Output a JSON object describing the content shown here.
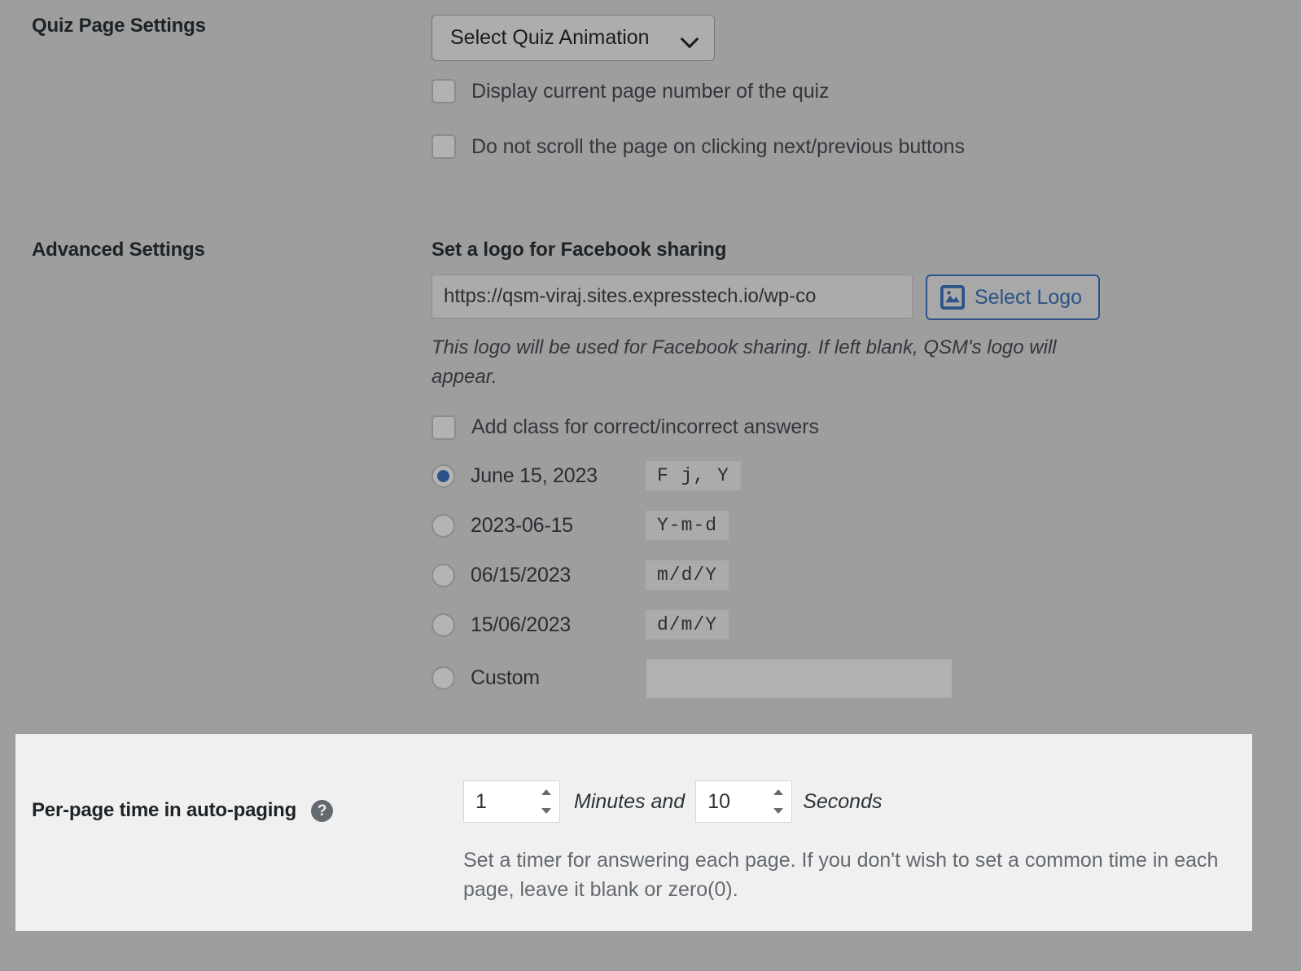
{
  "sections": {
    "quiz_page_settings": {
      "label": "Quiz Page Settings",
      "animation_select": {
        "value": "Select Quiz Animation",
        "icon": "chevron-down-icon"
      },
      "checkboxes": [
        {
          "label": "Display current page number of the quiz",
          "checked": false
        },
        {
          "label": "Do not scroll the page on clicking next/previous buttons",
          "checked": false
        }
      ]
    },
    "advanced_settings": {
      "label": "Advanced Settings",
      "logo_heading": "Set a logo for Facebook sharing",
      "logo_input_value": "https://qsm-viraj.sites.expresstech.io/wp-co",
      "select_logo_button": {
        "label": "Select Logo",
        "icon": "media-image-icon"
      },
      "logo_description": "This logo will be used for Facebook sharing. If left blank, QSM's logo will appear.",
      "add_class_checkbox": {
        "label": "Add class for correct/incorrect answers",
        "checked": false
      },
      "date_formats": [
        {
          "label": "June 15, 2023",
          "format": "F j, Y",
          "checked": true
        },
        {
          "label": "2023-06-15",
          "format": "Y-m-d",
          "checked": false
        },
        {
          "label": "06/15/2023",
          "format": "m/d/Y",
          "checked": false
        },
        {
          "label": "15/06/2023",
          "format": "d/m/Y",
          "checked": false
        },
        {
          "label": "Custom",
          "format": "",
          "checked": false,
          "custom_value": ""
        }
      ]
    },
    "per_page_time": {
      "label": "Per-page time in auto-paging",
      "help_icon": "help-question-icon",
      "help_glyph": "?",
      "minutes_value": "1",
      "minutes_unit": "Minutes and",
      "seconds_value": "10",
      "seconds_unit": "Seconds",
      "description": "Set a timer for answering each page. If you don't wish to set a common time in each page, leave it blank or zero(0)."
    }
  },
  "colors": {
    "page_background": "#9e9e9e",
    "highlight_panel": "#f0f0f0",
    "accent_blue": "#2b5387",
    "help_icon_gray": "#646970"
  }
}
